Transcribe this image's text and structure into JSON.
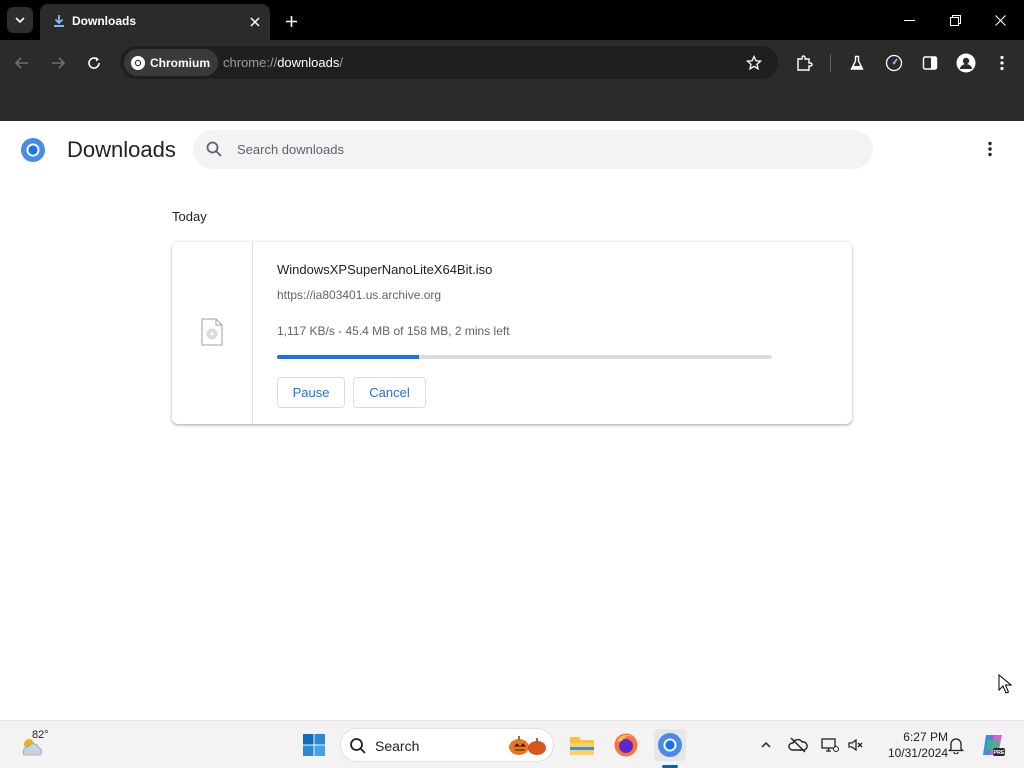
{
  "browser": {
    "tab": {
      "title": "Downloads"
    },
    "toolbar": {
      "site_chip": "Chromium",
      "url_scheme": "chrome://",
      "url_host": "downloads",
      "url_path": "/"
    }
  },
  "page": {
    "title": "Downloads",
    "search_placeholder": "Search downloads",
    "date_group": "Today",
    "download": {
      "file_name": "WindowsXPSuperNanoLiteX64Bit.iso",
      "source_url": "https://ia803401.us.archive.org",
      "status": "1,117 KB/s - 45.4 MB of 158 MB, 2 mins left",
      "progress_fraction": 0.287,
      "pause_label": "Pause",
      "cancel_label": "Cancel"
    }
  },
  "taskbar": {
    "weather_temp": "82°",
    "search_label": "Search",
    "time": "6:27 PM",
    "date": "10/31/2024"
  },
  "colors": {
    "accent": "#1a73e8",
    "tabstrip": "#000000",
    "toolbar": "#2b2b2b"
  }
}
